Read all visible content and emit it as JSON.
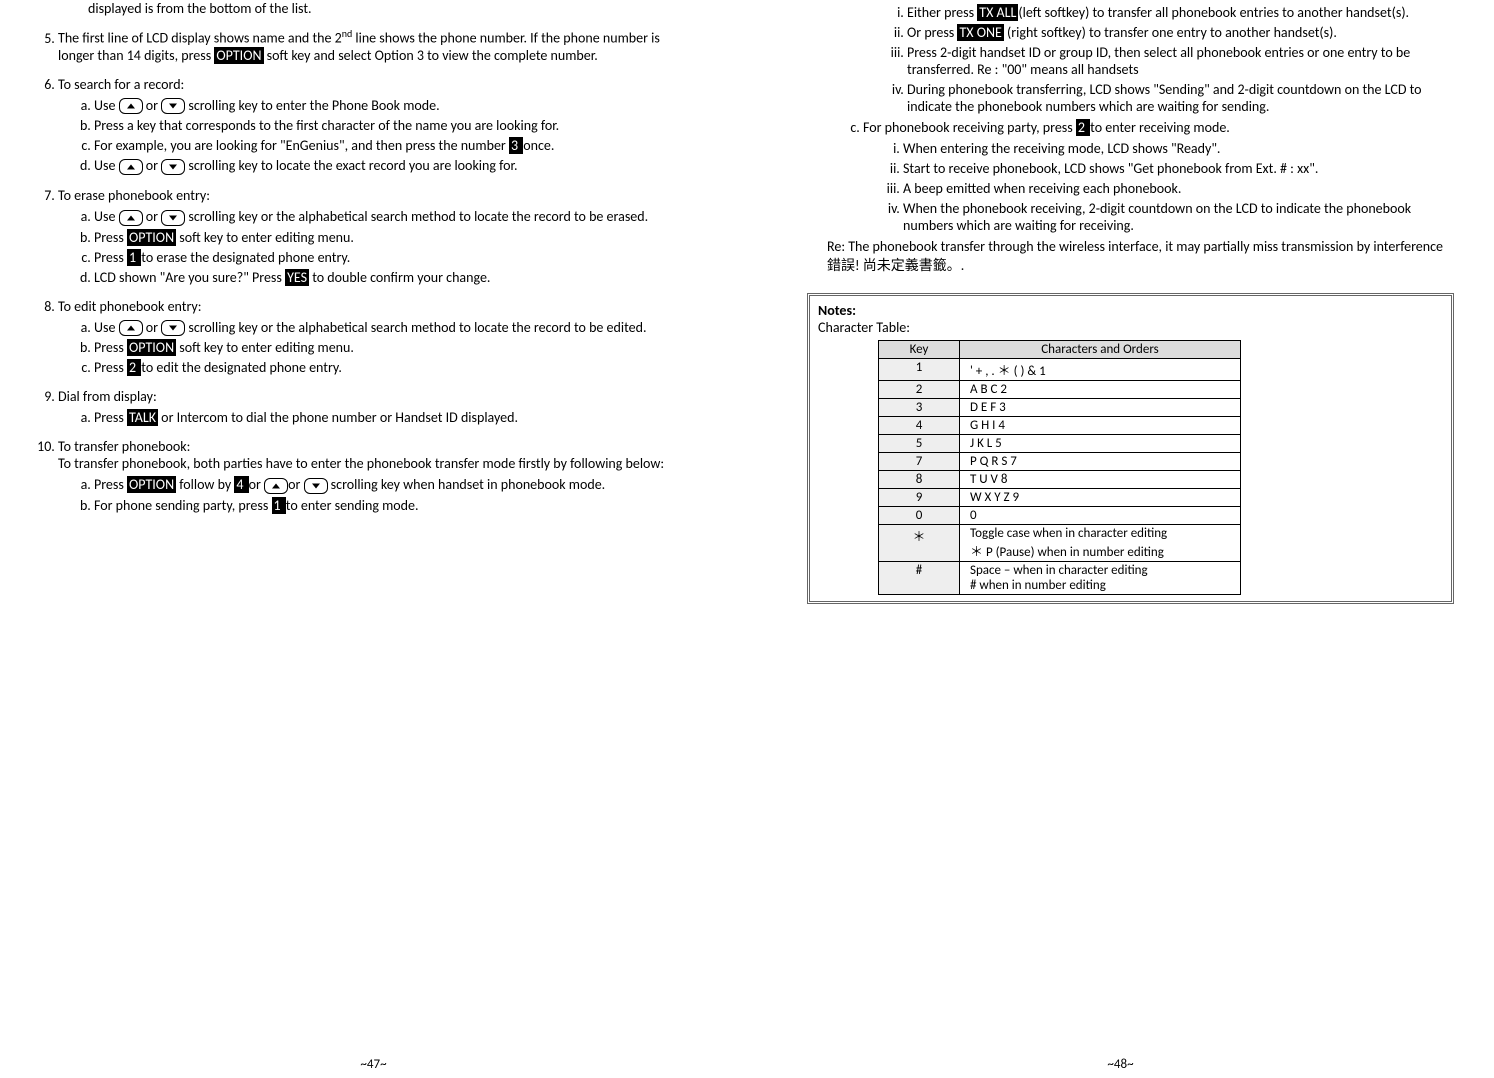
{
  "left": {
    "frag": "displayed is from the bottom of the list.",
    "item5_a": "The first line of LCD display shows name and the 2",
    "item5_sup": "nd",
    "item5_b": " line shows the phone number.  If the phone number is longer than 14 digits, press ",
    "item5_opt": "OPTION",
    "item5_c": " soft key and select Option 3 to view the complete number.",
    "item6_t": "To search for a record:",
    "item6a_a": "Use ",
    "item6a_b": " or ",
    "item6a_c": " scrolling key to enter the Phone Book mode.",
    "item6b": "Press a key that corresponds to the first character of the name you are looking for.",
    "item6c_a": "For example, you are looking for \"EnGenius\", and then press the number ",
    "item6c_n": " 3 ",
    "item6c_b": " once.",
    "item6d_a": "Use  ",
    "item6d_b": " or ",
    "item6d_c": " scrolling key to locate the exact record you are looking for.",
    "item7_t": "To erase phonebook entry:",
    "item7a_a": "Use  ",
    "item7a_b": " or ",
    "item7a_c": " scrolling key or the alphabetical search method to locate the record to be erased.",
    "item7b_a": "Press ",
    "item7b_opt": "OPTION",
    "item7b_b": " soft key to enter editing menu.",
    "item7c_a": "Press ",
    "item7c_n": " 1 ",
    "item7c_b": " to erase the designated phone entry.",
    "item7d_a": "LCD shown \"Are you sure?\"  Press ",
    "item7d_yes": "YES",
    "item7d_b": " to double confirm your change.",
    "item8_t": "To edit phonebook entry:",
    "item8a_a": "Use ",
    "item8a_b": " or ",
    "item8a_c": " scrolling key or the alphabetical search method to locate the record to be edited.",
    "item8b_a": "Press ",
    "item8b_opt": "OPTION",
    "item8b_b": " soft key to enter editing menu.",
    "item8c_a": "Press ",
    "item8c_n": " 2 ",
    "item8c_b": " to edit the designated phone entry.",
    "item9_t": "Dial from display:",
    "item9a_a": "Press ",
    "item9a_talk": "TALK",
    "item9a_b": " or Intercom to dial the phone number or Handset ID displayed.",
    "item10_t": "To transfer phonebook:",
    "item10_p": "To transfer phonebook, both parties have to enter the phonebook transfer mode firstly by following below:",
    "item10a_a": "Press ",
    "item10a_opt": "OPTION",
    "item10a_b": " follow by ",
    "item10a_n": " 4 ",
    "item10a_c": " or ",
    "item10a_d": "or ",
    "item10a_e": " scrolling key when handset in phonebook mode.",
    "item10b_a": "For phone sending party, press ",
    "item10b_n": " 1 ",
    "item10b_b": "to enter sending mode.",
    "pagenum": "~47~"
  },
  "right": {
    "bi_a": "Either press ",
    "bi_tx": "TX ALL",
    "bi_b": "(left softkey) to transfer all phonebook entries to another handset(s).",
    "bii_a": "Or press ",
    "bii_tx": "TX ONE",
    "bii_b": " (right softkey) to transfer one entry to another handset(s).",
    "biii": "Press 2-digit handset ID or group ID, then select all phonebook entries or one entry to be transferred.  Re : \"00\" means all handsets",
    "biv": "During phonebook transferring, LCD shows \"Sending\" and 2-digit countdown on the LCD to indicate the phonebook numbers which are waiting for sending.",
    "c_a": "For phonebook receiving party, press ",
    "c_n": " 2 ",
    "c_b": " to enter receiving mode.",
    "ci": "When entering the receiving mode, LCD shows \"Ready\".",
    "cii": "Start to receive phonebook, LCD shows \"Get phonebook from Ext. # : xx\".",
    "ciii": "A beep emitted when receiving each phonebook.",
    "civ": "When the phonebook receiving, 2-digit countdown on the LCD to indicate the phonebook numbers which are waiting for receiving.",
    "re_a": "Re:  The phonebook transfer through the wireless interface, it may partially miss transmission by interference",
    "re_b": "錯誤! 尚未定義書籤。",
    "re_c": ".",
    "notes_t": "Notes:",
    "notes_sub": "Character Table:",
    "th_key": "Key",
    "th_chars": "Characters and Orders",
    "rows": [
      {
        "k": "1",
        "v": "' + , .  ＊  ( ) & 1"
      },
      {
        "k": "2",
        "v": "A B C 2"
      },
      {
        "k": "3",
        "v": "D E F 3"
      },
      {
        "k": "4",
        "v": "G H I 4"
      },
      {
        "k": "5",
        "v": "J K L 5"
      },
      {
        "k": "7",
        "v": "P Q R S 7"
      },
      {
        "k": "8",
        "v": "T U V 8"
      },
      {
        "k": "9",
        "v": "W X Y Z 9"
      },
      {
        "k": "0",
        "v": "0"
      },
      {
        "k": "＊",
        "v": "Toggle case when in character editing\n＊ P (Pause) when in number editing"
      },
      {
        "k": "#",
        "v": "Space – when in character editing\n# when in number editing"
      }
    ],
    "pagenum": "~48~"
  }
}
